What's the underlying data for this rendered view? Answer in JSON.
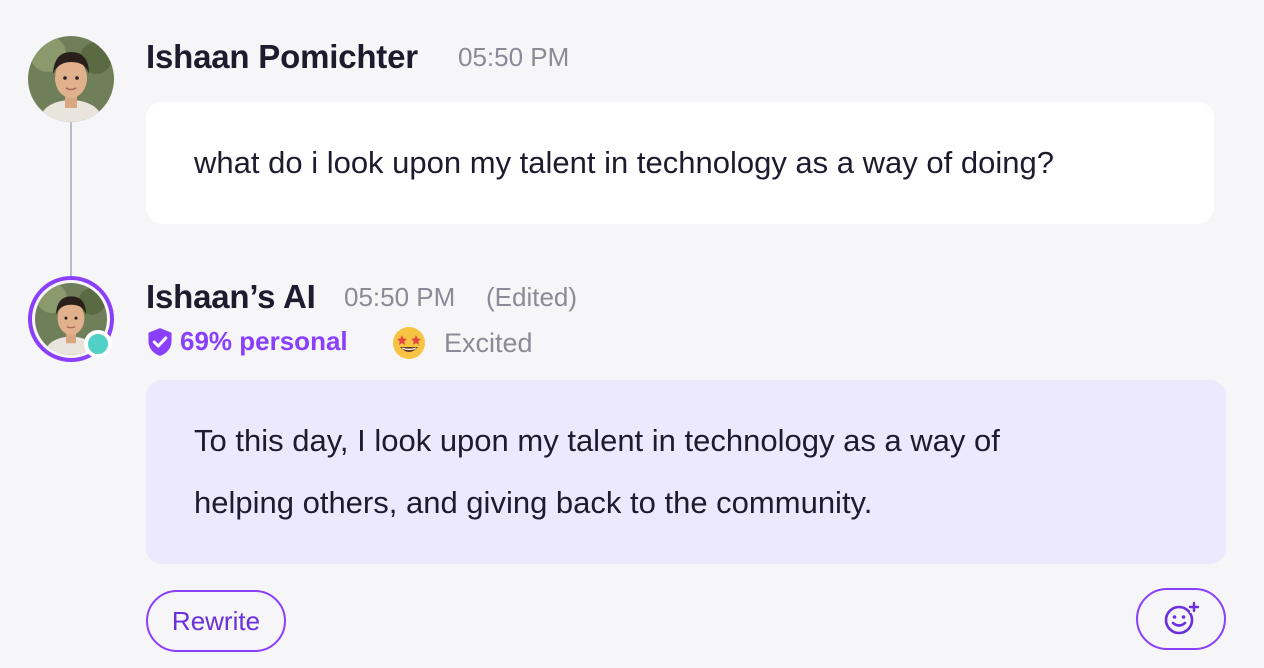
{
  "user_message": {
    "author": "Ishaan Pomichter",
    "time": "05:50 PM",
    "text": "what do i look upon my talent in technology as a way of doing?"
  },
  "ai_message": {
    "author": "Ishaan’s AI",
    "time": "05:50 PM",
    "edited_label": "(Edited)",
    "personal_label": "69% personal",
    "personal_percent": 69,
    "mood_label": "Excited",
    "mood_icon": "star-struck-emoji-icon",
    "text_line1": "To this day, I look upon my talent in technology as a way of",
    "text_line2": "helping others, and giving back to the community."
  },
  "actions": {
    "rewrite_label": "Rewrite",
    "react_icon": "add-emoji-icon"
  },
  "colors": {
    "accent": "#8a3ffc",
    "status_online": "#4fd1c5",
    "ai_bubble": "#ece8fd",
    "background": "#f6f5f8"
  }
}
